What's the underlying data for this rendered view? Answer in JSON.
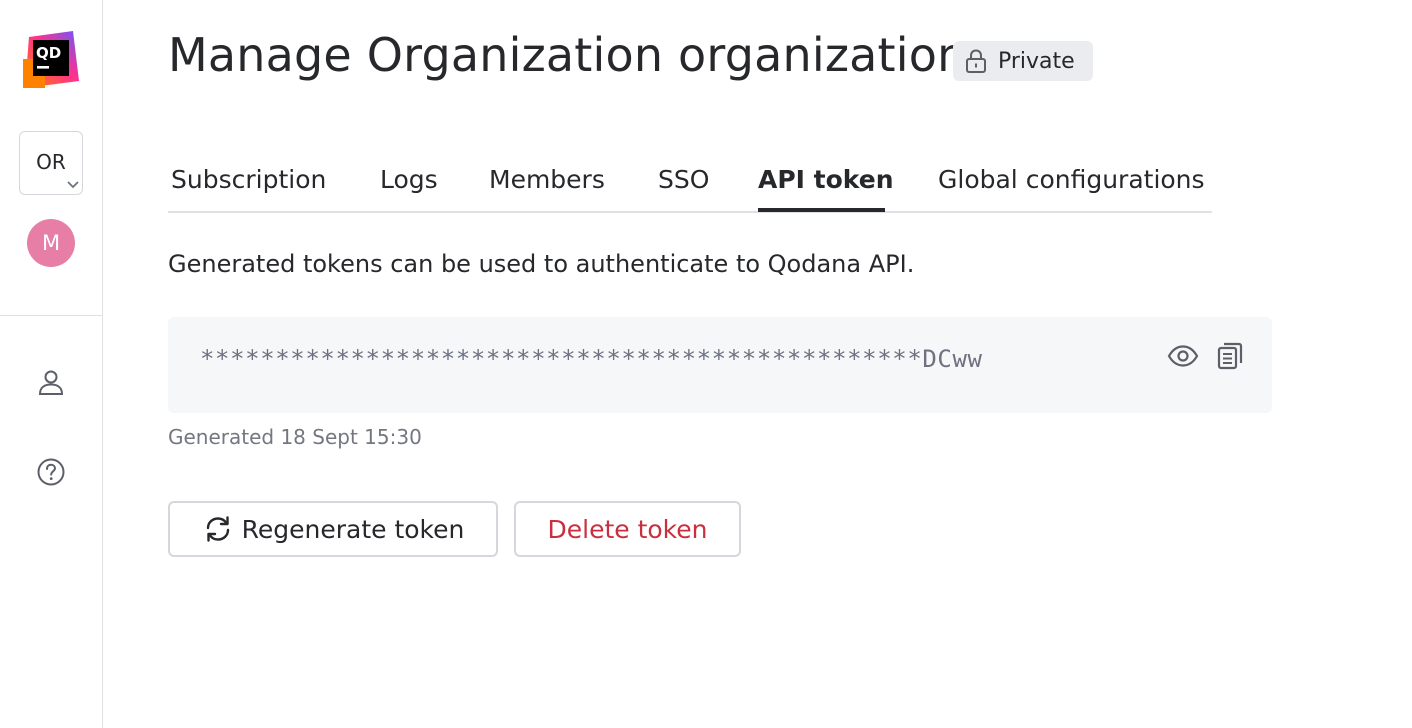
{
  "app": {
    "logo_text": "QD",
    "brand_colors": {
      "pink": "#ff318c",
      "orange": "#ff8100",
      "purple": "#6b57ff",
      "dark": "#000000"
    }
  },
  "sidebar": {
    "org_switcher": {
      "label": "OR",
      "icon": "chevron-down-icon"
    },
    "avatar": {
      "initial": "M",
      "color": "#e67ea6"
    },
    "nav_items": [
      {
        "icon": "user-icon",
        "name": "profile"
      },
      {
        "icon": "help-icon",
        "name": "help"
      }
    ]
  },
  "header": {
    "title": "Manage Organization organization",
    "badge": {
      "icon": "lock-icon",
      "label": "Private"
    }
  },
  "tabs": [
    {
      "label": "Subscription",
      "active": false
    },
    {
      "label": "Logs",
      "active": false
    },
    {
      "label": "Members",
      "active": false
    },
    {
      "label": "SSO",
      "active": false
    },
    {
      "label": "API token",
      "active": true
    },
    {
      "label": "Global configurations",
      "active": false
    }
  ],
  "api_token": {
    "description": "Generated tokens can be used to authenticate to Qodana API.",
    "masked_value": "************************************************DCww",
    "actions": [
      {
        "icon": "eye-icon",
        "name": "show-token"
      },
      {
        "icon": "copy-icon",
        "name": "copy-token"
      }
    ],
    "generated_info": "Generated 18 Sept 15:30",
    "buttons": {
      "regenerate": {
        "label": "Regenerate token",
        "icon": "refresh-icon"
      },
      "delete": {
        "label": "Delete token",
        "color": "#c9303f"
      }
    }
  },
  "colors": {
    "text": "#27282c",
    "muted": "#747780",
    "border": "#dfe1e5",
    "danger": "#c9303f",
    "token_bg": "#f6f7f9",
    "badge_bg": "#ebecf0"
  }
}
